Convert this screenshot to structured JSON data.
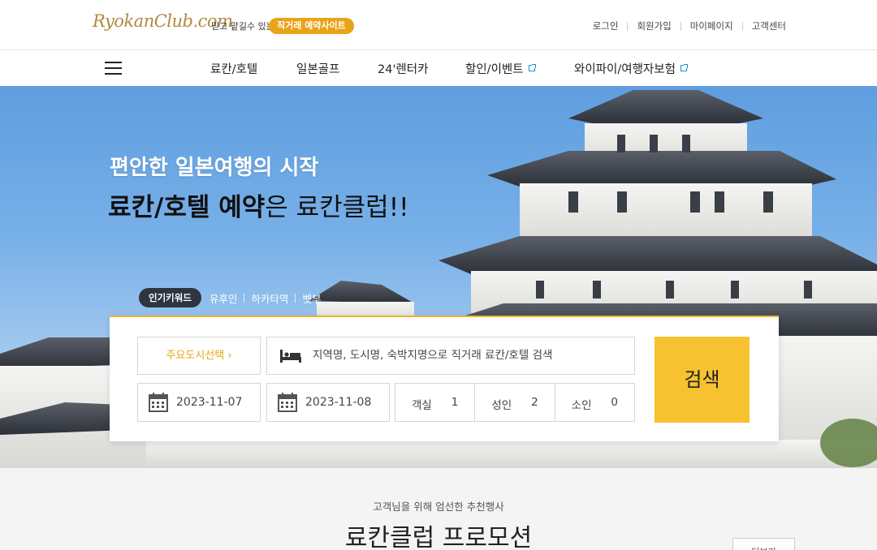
{
  "header": {
    "logo_text": "RyokanClub.com",
    "tagline": "믿고 맡길수 있는",
    "badge": "직거래 예약사이트",
    "util_links": [
      "로그인",
      "회원가입",
      "마이페이지",
      "고객센터"
    ]
  },
  "nav": {
    "items": [
      {
        "label": "료칸/호텔",
        "external": false
      },
      {
        "label": "일본골프",
        "external": false
      },
      {
        "label": "24'렌터카",
        "external": false
      },
      {
        "label": "할인/이벤트",
        "external": true
      },
      {
        "label": "와이파이/여행자보험",
        "external": true
      }
    ]
  },
  "hero": {
    "line1": "편안한 일본여행의 시작",
    "line2_bold": "료칸/호텔 예약",
    "line2_rest": "은 료칸클럽!!",
    "keywords_label": "인기키워드",
    "keywords": [
      "유후인",
      "하카타역",
      "벳부"
    ]
  },
  "search": {
    "city_button": "주요도시선택  ›",
    "query_placeholder": "지역명, 도시명, 숙박지명으로 직거래 료칸/호텔 검색",
    "checkin": "2023-11-07",
    "checkout": "2023-11-08",
    "rooms_label": "객실",
    "rooms_value": "1",
    "adults_label": "성인",
    "adults_value": "2",
    "children_label": "소인",
    "children_value": "0",
    "button": "검색"
  },
  "promo": {
    "subtitle": "고객님을 위해 엄선한 추천행사",
    "title": "료칸클럽 프로모션",
    "more_button": "더보기"
  },
  "colors": {
    "accent": "#f7c230",
    "badge": "#e8a317",
    "link_icon": "#1e8bd6"
  }
}
